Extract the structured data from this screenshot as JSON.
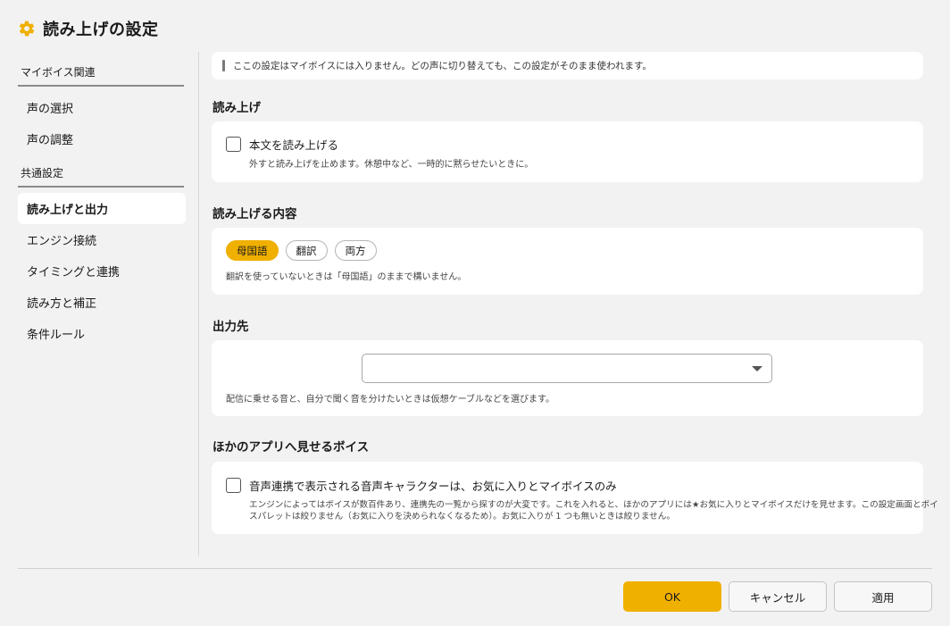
{
  "window": {
    "title": "読み上げの設定",
    "icon": "gear-icon",
    "accent_color": "#f0b000"
  },
  "sidebar": {
    "groups": [
      {
        "label": "マイボイス関連",
        "items": [
          {
            "label": "声の選択",
            "active": false
          },
          {
            "label": "声の調整",
            "active": false
          }
        ]
      },
      {
        "label": "共通設定",
        "items": [
          {
            "label": "読み上げと出力",
            "active": true
          },
          {
            "label": "エンジン接続",
            "active": false
          },
          {
            "label": "タイミングと連携",
            "active": false
          },
          {
            "label": "読み方と補正",
            "active": false
          },
          {
            "label": "条件ルール",
            "active": false
          }
        ]
      }
    ]
  },
  "notice": {
    "text": "ここの設定はマイボイスには入りません。どの声に切り替えても、この設定がそのまま使われます。"
  },
  "sections": {
    "read_aloud": {
      "heading": "読み上げ",
      "checkbox_label": "本文を読み上げる",
      "checked": false,
      "hint": "外すと読み上げを止めます。休憩中など、一時的に黙らせたいときに。"
    },
    "content": {
      "heading": "読み上げる内容",
      "options": [
        {
          "label": "母国語",
          "selected": true
        },
        {
          "label": "翻訳",
          "selected": false
        },
        {
          "label": "両方",
          "selected": false
        }
      ],
      "hint": "翻訳を使っていないときは「母国語」のままで構いません。"
    },
    "output": {
      "heading": "出力先",
      "selected_value": "",
      "hint": "配信に乗せる音と、自分で聞く音を分けたいときは仮想ケーブルなどを選びます。"
    },
    "voices": {
      "heading": "ほかのアプリへ見せるボイス",
      "checkbox_label": "音声連携で表示される音声キャラクターは、お気に入りとマイボイスのみ",
      "checked": false,
      "hint_line1": "エンジンによってはボイスが数百件あり、連携先の一覧から探すのが大変です。これを入れると、ほかのアプリには★お気に入りとマイボイスだけを見せます。この設定画面とボイ",
      "hint_line2": "スパレットは絞りません（お気に入りを決められなくなるため）。お気に入りが 1 つも無いときは絞りません。"
    }
  },
  "footer": {
    "ok_label": "OK",
    "cancel_label": "キャンセル",
    "apply_label": "適用"
  }
}
